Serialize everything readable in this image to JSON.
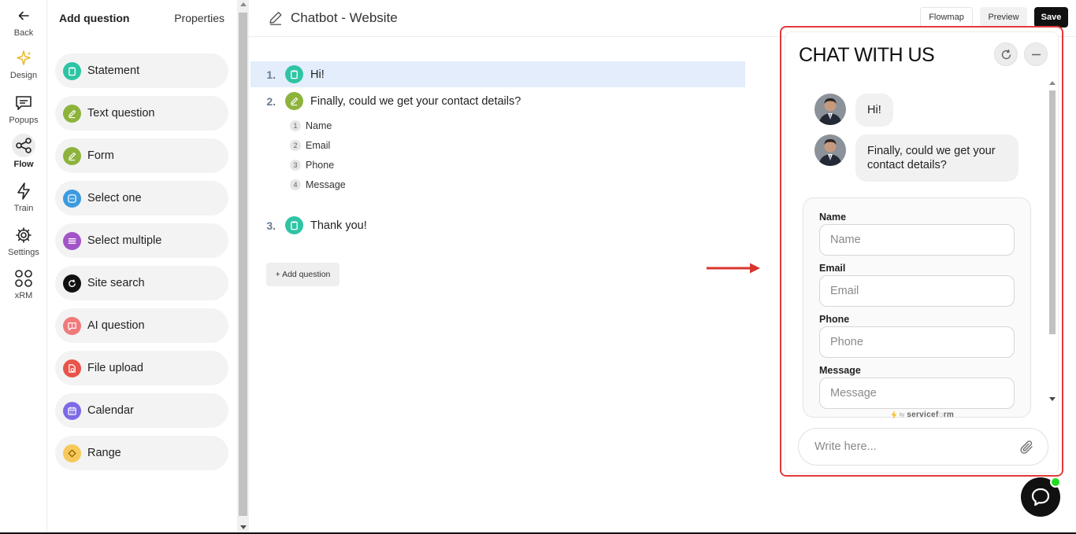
{
  "rail": {
    "back": "Back",
    "items": [
      {
        "label": "Design",
        "icon": "sparkle-icon"
      },
      {
        "label": "Popups",
        "icon": "chat-icon"
      },
      {
        "label": "Flow",
        "icon": "share-icon"
      },
      {
        "label": "Train",
        "icon": "bolt-icon"
      },
      {
        "label": "Settings",
        "icon": "gear-icon"
      },
      {
        "label": "xRM",
        "icon": "grid-icon"
      }
    ]
  },
  "panel": {
    "tab_add": "Add question",
    "tab_properties": "Properties",
    "types": [
      {
        "label": "Statement",
        "color": "#2ec4a4"
      },
      {
        "label": "Text question",
        "color": "#8db33c"
      },
      {
        "label": "Form",
        "color": "#8db33c"
      },
      {
        "label": "Select one",
        "color": "#3d9be0"
      },
      {
        "label": "Select multiple",
        "color": "#a254c9"
      },
      {
        "label": "Site search",
        "color": "#111111"
      },
      {
        "label": "AI question",
        "color": "#f07a7a"
      },
      {
        "label": "File upload",
        "color": "#e8544a"
      },
      {
        "label": "Calendar",
        "color": "#7c6ae6"
      },
      {
        "label": "Range",
        "color": "#f7c95a"
      }
    ]
  },
  "header": {
    "title": "Chatbot - Website",
    "flowmap": "Flowmap",
    "preview": "Preview",
    "save": "Save"
  },
  "flow": {
    "q1": {
      "num": "1.",
      "text": "Hi!"
    },
    "q2": {
      "num": "2.",
      "text": "Finally, could we get your contact details?"
    },
    "fields": [
      {
        "num": "1",
        "label": "Name"
      },
      {
        "num": "2",
        "label": "Email"
      },
      {
        "num": "3",
        "label": "Phone"
      },
      {
        "num": "4",
        "label": "Message"
      }
    ],
    "q3": {
      "num": "3.",
      "text": "Thank you!"
    },
    "add_question": "+ Add question"
  },
  "chat": {
    "title": "CHAT WITH US",
    "msg1": "Hi!",
    "msg2": "Finally, could we get your contact details?",
    "form": {
      "name_label": "Name",
      "name_ph": "Name",
      "email_label": "Email",
      "email_ph": "Email",
      "phone_label": "Phone",
      "phone_ph": "Phone",
      "message_label": "Message",
      "message_ph": "Message"
    },
    "brand_by": "by",
    "brand_name": "servicef◌rm",
    "composer_ph": "Write here..."
  },
  "colors": {
    "highlight": "#e3edfb",
    "outline": "#e23a3a",
    "online": "#22dd22"
  }
}
